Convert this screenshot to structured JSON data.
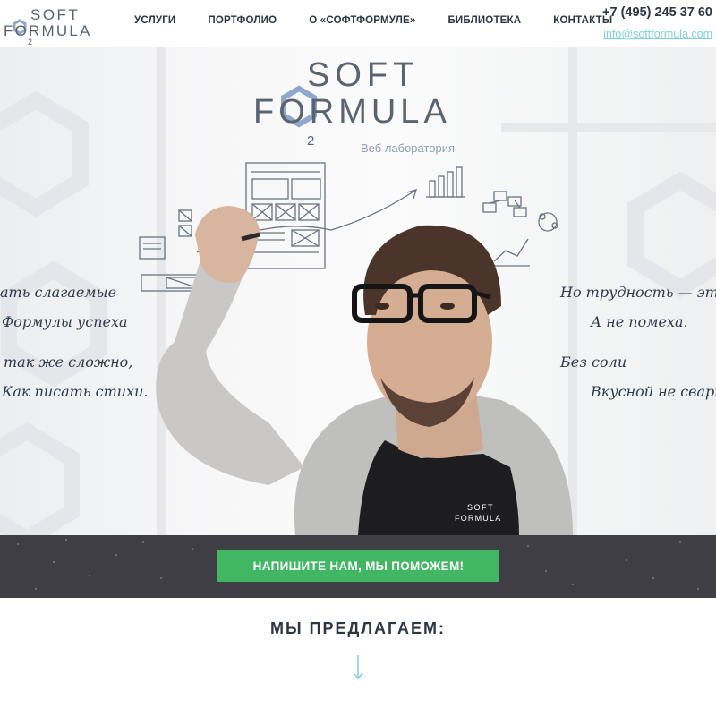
{
  "header": {
    "logo_top": "SOFT",
    "logo_bottom": "FORMULA",
    "logo_index": "2",
    "nav": [
      {
        "label": "УСЛУГИ"
      },
      {
        "label": "ПОРТФОЛИО"
      },
      {
        "label": "О «СОФТФОРМУЛЕ»"
      },
      {
        "label": "БИБЛИОТЕКА"
      },
      {
        "label": "КОНТАКТЫ"
      }
    ],
    "phone": "+7 (495) 245 37 60",
    "email": "info@softformula.com"
  },
  "hero": {
    "logo_top": "SOFT",
    "logo_bottom": "FORMULA",
    "logo_index": "2",
    "subtitle": "Веб лаборатория",
    "shirt_logo_top": "SOFT",
    "shirt_logo_bottom": "FORMULA",
    "left_lines": [
      "ать слагаемые",
      "Формулы успеха",
      "так же сложно,",
      "Как писать стихи."
    ],
    "right_lines": [
      "Но трудность — эт",
      "А не помеха.",
      "Без соли",
      "Вкусной не свари"
    ]
  },
  "cta": {
    "label": "НАПИШИТЕ НАМ, МЫ ПОМОЖЕМ!"
  },
  "offers": {
    "title": "МЫ ПРЕДЛАГАЕМ:"
  },
  "colors": {
    "dark_text": "#2d3642",
    "accent_cyan": "#7ed2d8",
    "hex_blue": "#8fa8cc",
    "cta_green": "#41b763",
    "band_dark": "#3e3e44"
  },
  "icons": [
    "hexagon-logo-icon",
    "arrow-down-icon"
  ]
}
